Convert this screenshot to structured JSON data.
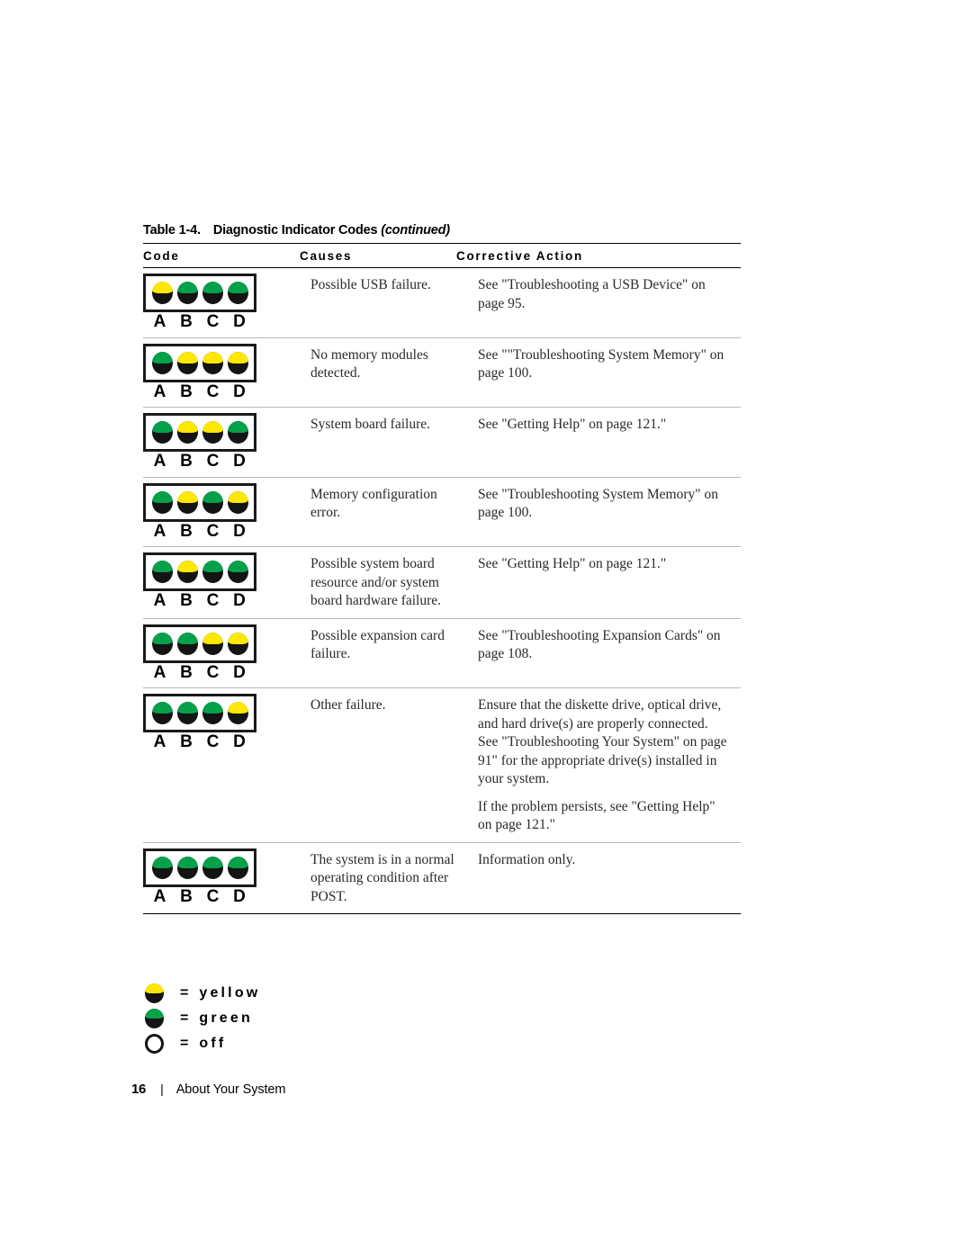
{
  "document": {
    "table_caption": {
      "number": "Table 1-4.",
      "title": "Diagnostic Indicator Codes",
      "continued": "(continued)"
    },
    "headers": {
      "code": "Code",
      "causes": "Causes",
      "action": "Corrective Action"
    },
    "rows": [
      {
        "leds": [
          "yellow",
          "green",
          "green",
          "green"
        ],
        "led_labels": [
          "A",
          "B",
          "C",
          "D"
        ],
        "cause": "Possible USB failure.",
        "action_paragraphs": [
          "See \"Troubleshooting a USB Device\" on page 95."
        ]
      },
      {
        "leds": [
          "green",
          "yellow",
          "yellow",
          "yellow"
        ],
        "led_labels": [
          "A",
          "B",
          "C",
          "D"
        ],
        "cause": "No memory modules detected.",
        "action_paragraphs": [
          "See \"\"Troubleshooting System Memory\" on page 100."
        ]
      },
      {
        "leds": [
          "green",
          "yellow",
          "yellow",
          "green"
        ],
        "led_labels": [
          "A",
          "B",
          "C",
          "D"
        ],
        "cause": "System board failure.",
        "action_paragraphs": [
          "See \"Getting Help\" on page 121.\""
        ]
      },
      {
        "leds": [
          "green",
          "yellow",
          "green",
          "yellow"
        ],
        "led_labels": [
          "A",
          "B",
          "C",
          "D"
        ],
        "cause": "Memory configuration error.",
        "action_paragraphs": [
          "See \"Troubleshooting System Memory\" on page 100."
        ]
      },
      {
        "leds": [
          "green",
          "yellow",
          "green",
          "green"
        ],
        "led_labels": [
          "A",
          "B",
          "C",
          "D"
        ],
        "cause": "Possible system board resource and/or system board hardware failure.",
        "action_paragraphs": [
          "See \"Getting Help\" on page 121.\""
        ]
      },
      {
        "leds": [
          "green",
          "green",
          "yellow",
          "yellow"
        ],
        "led_labels": [
          "A",
          "B",
          "C",
          "D"
        ],
        "cause": "Possible expansion card failure.",
        "action_paragraphs": [
          "See \"Troubleshooting Expansion Cards\" on page 108."
        ]
      },
      {
        "leds": [
          "green",
          "green",
          "green",
          "yellow"
        ],
        "led_labels": [
          "A",
          "B",
          "C",
          "D"
        ],
        "cause": "Other failure.",
        "action_paragraphs": [
          "Ensure that the diskette drive, optical drive, and hard drive(s) are properly connected. See \"Troubleshooting Your System\" on page 91\" for the appropriate drive(s) installed in your system.",
          "If the problem persists, see \"Getting Help\" on page 121.\""
        ]
      },
      {
        "leds": [
          "green",
          "green",
          "green",
          "green"
        ],
        "led_labels": [
          "A",
          "B",
          "C",
          "D"
        ],
        "cause": "The system is in a normal operating condition after POST.",
        "action_paragraphs": [
          "Information only."
        ]
      }
    ],
    "legend": [
      {
        "led": "yellow",
        "equals": "=",
        "label": "yellow"
      },
      {
        "led": "green",
        "equals": "=",
        "label": "green"
      },
      {
        "led": "off",
        "equals": "=",
        "label": "off"
      }
    ],
    "footer": {
      "page_number": "16",
      "separator": "|",
      "chapter_title": "About Your System"
    },
    "colors": {
      "led_yellow": "#FFE800",
      "led_green": "#04A14A",
      "led_body": "#141414",
      "rule_dark": "#000000",
      "rule_light": "#B9B9B9"
    }
  }
}
